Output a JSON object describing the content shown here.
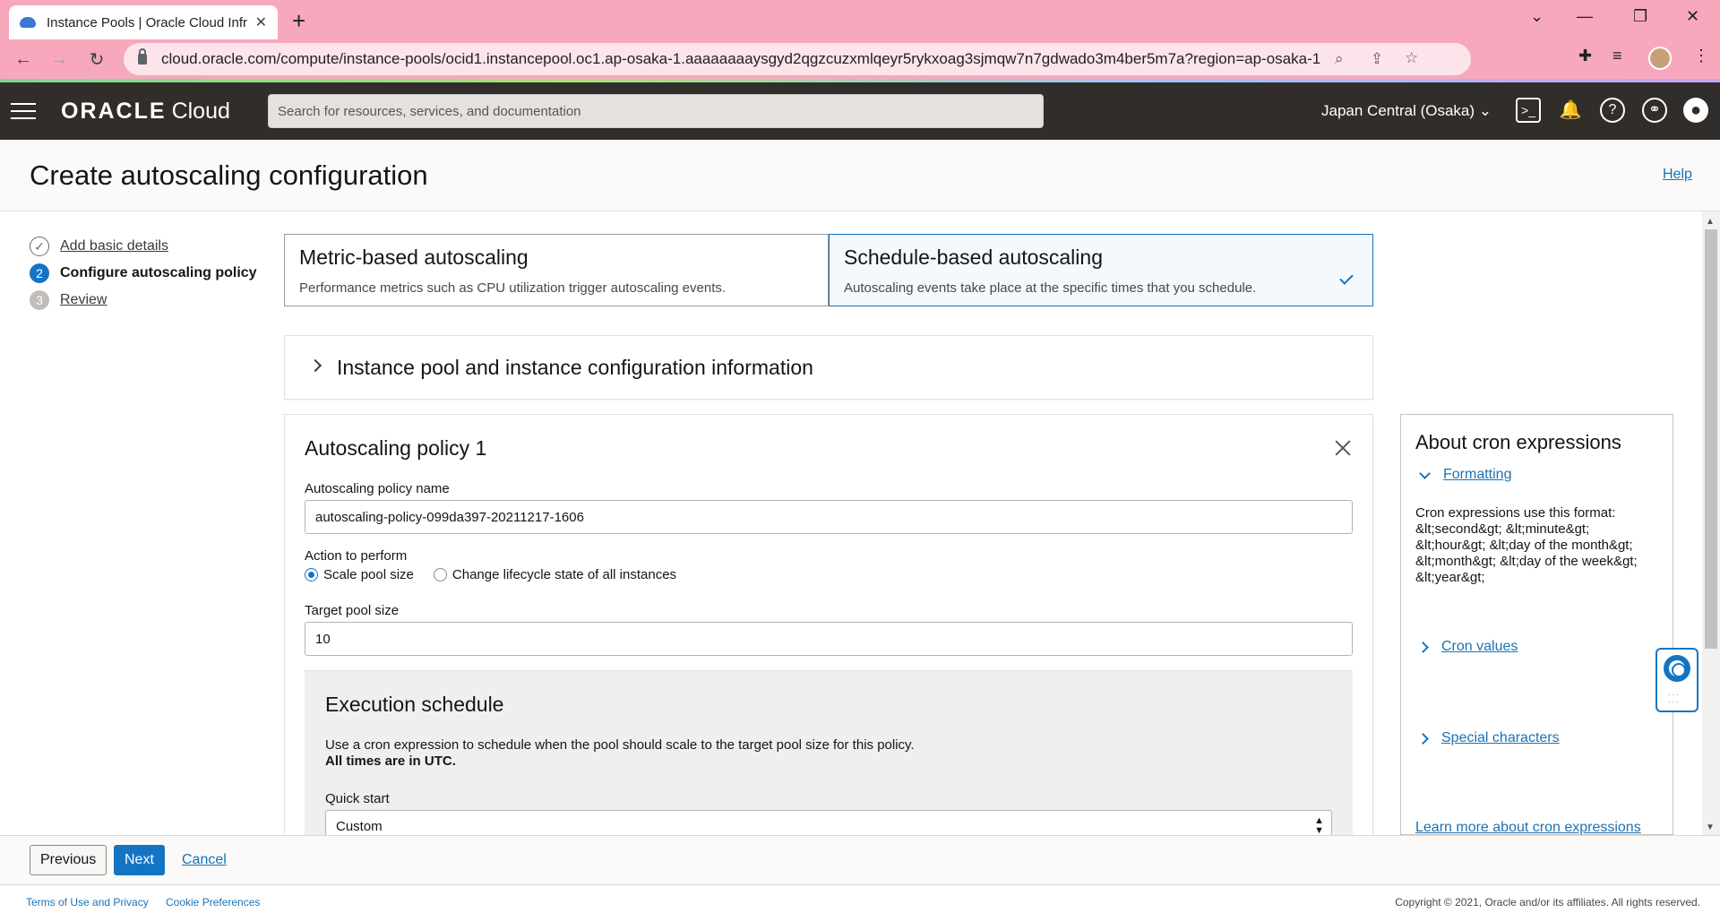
{
  "browser": {
    "tab_title": "Instance Pools | Oracle Cloud Infr",
    "tab_close": "✕",
    "new_tab": "+",
    "url": "cloud.oracle.com/compute/instance-pools/ocid1.instancepool.oc1.ap-osaka-1.aaaaaaaaysgyd2qgzcuzxmlqeyr5rykxoag3sjmqw7n7gdwado3m4ber5m7a?region=ap-osaka-1",
    "icons": [
      "back-icon",
      "forward-icon",
      "reload-icon",
      "lock-icon",
      "zoom-icon",
      "share-icon",
      "bookmark-star-icon",
      "extensions-icon",
      "media-icon",
      "profile-avatar"
    ]
  },
  "header": {
    "brand_bold": "ORACLE",
    "brand_light": "Cloud",
    "search_placeholder": "Search for resources, services, and documentation",
    "region": "Japan Central (Osaka)",
    "icons": [
      "cloud-shell-icon",
      "bell-icon",
      "help-icon",
      "globe-icon",
      "user-icon"
    ]
  },
  "page": {
    "title": "Create autoscaling configuration",
    "help": "Help"
  },
  "steps": [
    {
      "num": "",
      "label": "Add basic details",
      "state": "done"
    },
    {
      "num": "2",
      "label": "Configure autoscaling policy",
      "state": "active"
    },
    {
      "num": "3",
      "label": "Review",
      "state": "todo"
    }
  ],
  "modes": {
    "metric": {
      "title": "Metric-based autoscaling",
      "desc": "Performance metrics such as CPU utilization trigger autoscaling events."
    },
    "schedule": {
      "title": "Schedule-based autoscaling",
      "desc": "Autoscaling events take place at the specific times that you schedule.",
      "selected": true
    }
  },
  "instance_section": {
    "title": "Instance pool and instance configuration information"
  },
  "policy": {
    "title": "Autoscaling policy 1",
    "name_label": "Autoscaling policy name",
    "name_value": "autoscaling-policy-099da397-20211217-1606",
    "action_label": "Action to perform",
    "action_options": [
      "Scale pool size",
      "Change lifecycle state of all instances"
    ],
    "action_selected": "Scale pool size",
    "target_label": "Target pool size",
    "target_value": "10"
  },
  "execution": {
    "title": "Execution schedule",
    "desc": "Use a cron expression to schedule when the pool should scale to the target pool size for this policy.",
    "utc_note": "All times are in UTC.",
    "quick_start_label": "Quick start",
    "quick_start_value": "Custom"
  },
  "info": {
    "title": "About cron expressions",
    "formatting": "Formatting",
    "format_text": "Cron expressions use this format: &lt;second&gt; &lt;minute&gt; &lt;hour&gt; &lt;day of the month&gt; &lt;month&gt; &lt;day of the week&gt; &lt;year&gt;",
    "cron_values": "Cron values",
    "special_chars": "Special characters",
    "learn_more": "Learn more about cron expressions"
  },
  "actions": {
    "previous": "Previous",
    "next": "Next",
    "cancel": "Cancel"
  },
  "footer": {
    "terms": "Terms of Use and Privacy",
    "cookies": "Cookie Preferences",
    "copyright": "Copyright © 2021, Oracle and/or its affiliates. All rights reserved."
  },
  "colors": {
    "accent": "#1474c4",
    "header_bg": "#312d2a",
    "browser_frame": "#f7a8bc"
  }
}
